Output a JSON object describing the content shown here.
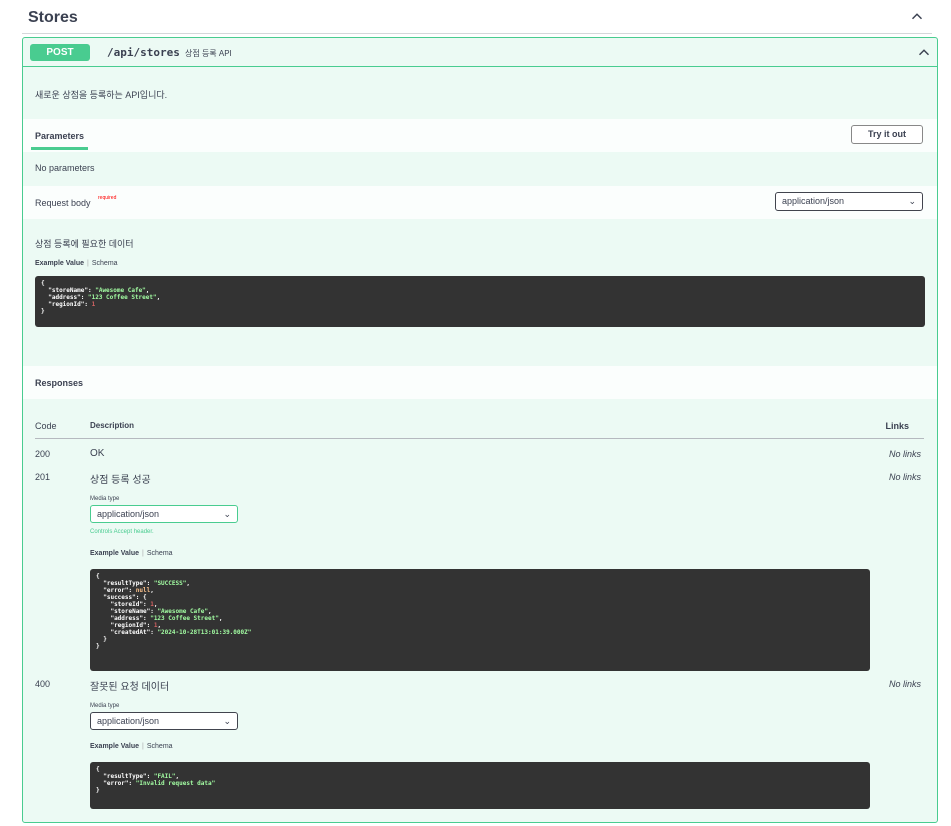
{
  "section": {
    "title": "Stores",
    "toggle_icon": "chevron-up-icon"
  },
  "operation": {
    "method": "POST",
    "path": "/api/stores",
    "summary": "상점 등록 API",
    "description": "새로운 상점을 등록하는 API입니다.",
    "method_color": "#49cc90"
  },
  "parameters": {
    "tab_label": "Parameters",
    "try_button": "Try it out",
    "no_params": "No parameters"
  },
  "request_body": {
    "label": "Request body",
    "required": "required",
    "content_type": "application/json",
    "description": "상점 등록에 필요한 데이터",
    "example_tab": "Example Value",
    "schema_tab": "Schema",
    "example": {
      "l1": "{",
      "k1": "\"storeName\"",
      "v1": "\"Awesome Cafe\"",
      "k2": "\"address\"",
      "v2": "\"123 Coffee Street\"",
      "k3": "\"regionId\"",
      "v3": "1",
      "l5": "}"
    }
  },
  "responses": {
    "label": "Responses",
    "col_code": "Code",
    "col_desc": "Description",
    "col_links": "Links",
    "media_type_label": "Media type",
    "accept_text": "Controls Accept header.",
    "example_tab": "Example Value",
    "schema_tab": "Schema",
    "items": [
      {
        "code": "200",
        "description": "OK",
        "links": "No links"
      },
      {
        "code": "201",
        "description": "상점 등록 성공",
        "links": "No links",
        "media_type": "application/json"
      },
      {
        "code": "400",
        "description": "잘못된 요청 데이터",
        "links": "No links",
        "media_type": "application/json"
      }
    ],
    "example_201": {
      "open": "{",
      "k_rt": "\"resultType\"",
      "v_rt": "\"SUCCESS\"",
      "k_err": "\"error\"",
      "v_err": "null",
      "k_succ": "\"success\"",
      "v_succ_open": "{",
      "k_sid": "\"storeId\"",
      "v_sid": "1",
      "k_sname": "\"storeName\"",
      "v_sname": "\"Awesome Cafe\"",
      "k_addr": "\"address\"",
      "v_addr": "\"123 Coffee Street\"",
      "k_rid": "\"regionId\"",
      "v_rid": "1",
      "k_cat": "\"createdAt\"",
      "v_cat": "\"2024-10-28T13:01:39.000Z\"",
      "inner_close": "}",
      "close": "}"
    },
    "example_400": {
      "open": "{",
      "k_rt": "\"resultType\"",
      "v_rt": "\"FAIL\"",
      "k_err": "\"error\"",
      "v_err": "\"Invalid request data\"",
      "close": "}"
    }
  }
}
